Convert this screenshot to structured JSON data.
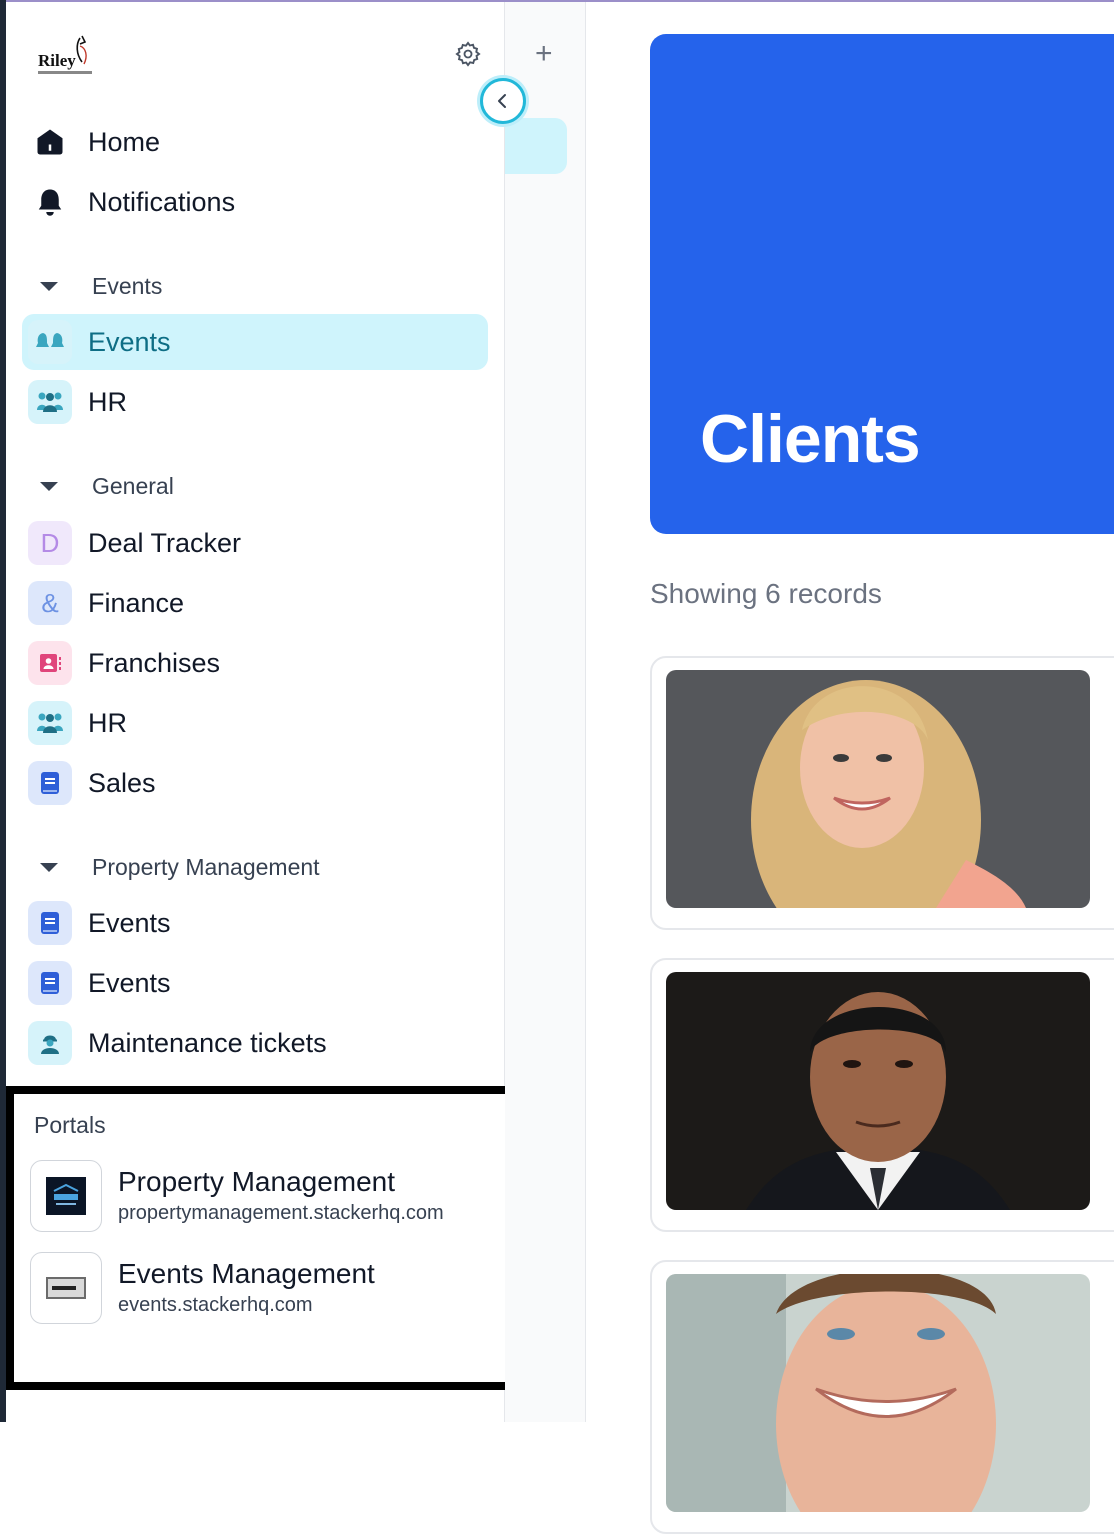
{
  "sidebar": {
    "logo_text": "Riley",
    "nav": [
      {
        "label": "Home"
      },
      {
        "label": "Notifications"
      }
    ],
    "groups": [
      {
        "label": "Events",
        "items": [
          {
            "label": "Events"
          },
          {
            "label": "HR"
          }
        ]
      },
      {
        "label": "General",
        "items": [
          {
            "label": "Deal Tracker",
            "icon_letter": "D"
          },
          {
            "label": "Finance",
            "icon_letter": "&"
          },
          {
            "label": "Franchises"
          },
          {
            "label": "HR"
          },
          {
            "label": "Sales"
          }
        ]
      },
      {
        "label": "Property Management",
        "items": [
          {
            "label": "Events"
          },
          {
            "label": "Events"
          },
          {
            "label": "Maintenance tickets"
          }
        ]
      }
    ]
  },
  "portals": {
    "title": "Portals",
    "items": [
      {
        "name": "Property Management",
        "url": "propertymanagement.stackerhq.com"
      },
      {
        "name": "Events Management",
        "url": "events.stackerhq.com"
      }
    ]
  },
  "main": {
    "title": "Clients",
    "records_text": "Showing 6 records"
  },
  "colors": {
    "accent": "#2563eb",
    "active_bg": "#cff4fc",
    "active_text": "#0e6e85"
  }
}
